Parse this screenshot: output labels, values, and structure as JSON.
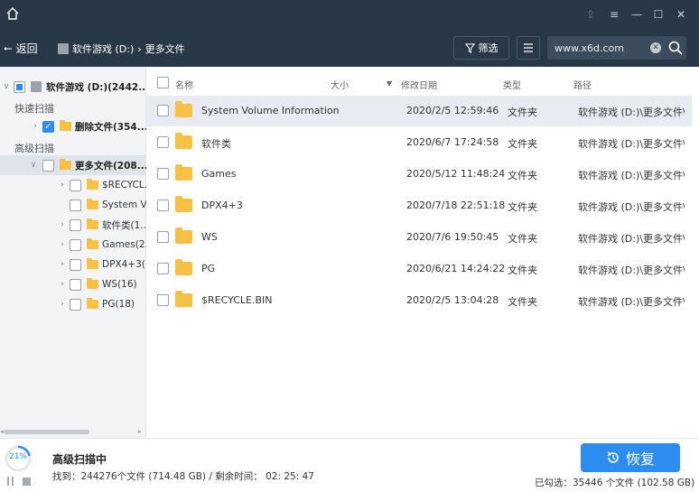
{
  "nav": {
    "back_label": "返回",
    "breadcrumb": [
      "软件游戏 (D:)",
      "更多文件"
    ],
    "filter_label": "筛选",
    "search_value": "www.x6d.com"
  },
  "sidebar": {
    "root_label": "软件游戏 (D:)(2442...",
    "quick_scan_label": "快速扫描",
    "deleted_label": "删除文件(354...",
    "advanced_scan_label": "高级扫描",
    "more_files_label": "更多文件(208...",
    "children": [
      {
        "label": "$RECYCL..."
      },
      {
        "label": "System V..."
      },
      {
        "label": "软件类(1..."
      },
      {
        "label": "Games(2..."
      },
      {
        "label": "DPX4+3(..."
      },
      {
        "label": "WS(16)"
      },
      {
        "label": "PG(18)"
      }
    ]
  },
  "table": {
    "headers": {
      "name": "名称",
      "size": "大小",
      "date": "修改日期",
      "type": "类型",
      "path": "路径"
    },
    "rows": [
      {
        "name": "System Volume Information",
        "date": "2020/2/5 12:59:46",
        "type": "文件夹",
        "path": "软件游戏 (D:)\\更多文件\\S..."
      },
      {
        "name": "软件类",
        "date": "2020/6/7 17:24:58",
        "type": "文件夹",
        "path": "软件游戏 (D:)\\更多文件\\软..."
      },
      {
        "name": "Games",
        "date": "2020/5/12 11:48:24",
        "type": "文件夹",
        "path": "软件游戏 (D:)\\更多文件\\G..."
      },
      {
        "name": "DPX4+3",
        "date": "2020/7/18 22:51:18",
        "type": "文件夹",
        "path": "软件游戏 (D:)\\更多文件\\D..."
      },
      {
        "name": "WS",
        "date": "2020/7/6 19:50:45",
        "type": "文件夹",
        "path": "软件游戏 (D:)\\更多文件\\W..."
      },
      {
        "name": "PG",
        "date": "2020/6/21 14:24:22",
        "type": "文件夹",
        "path": "软件游戏 (D:)\\更多文件\\P..."
      },
      {
        "name": "$RECYCLE.BIN",
        "date": "2020/2/5 13:04:28",
        "type": "文件夹",
        "path": "软件游戏 (D:)\\更多文件\\$..."
      }
    ]
  },
  "status": {
    "progress_percent": 21,
    "progress_label": "21%",
    "title": "高级扫描中",
    "detail": "找到：244276个文件 (714.48 GB) / 剩余时间： 02: 25: 47",
    "recover_label": "恢复",
    "selected_info": "已勾选：35446 个文件 (102.58 GB)"
  },
  "colors": {
    "accent": "#2d8cf0",
    "header_bg": "#293849",
    "folder": "#f8c143"
  }
}
